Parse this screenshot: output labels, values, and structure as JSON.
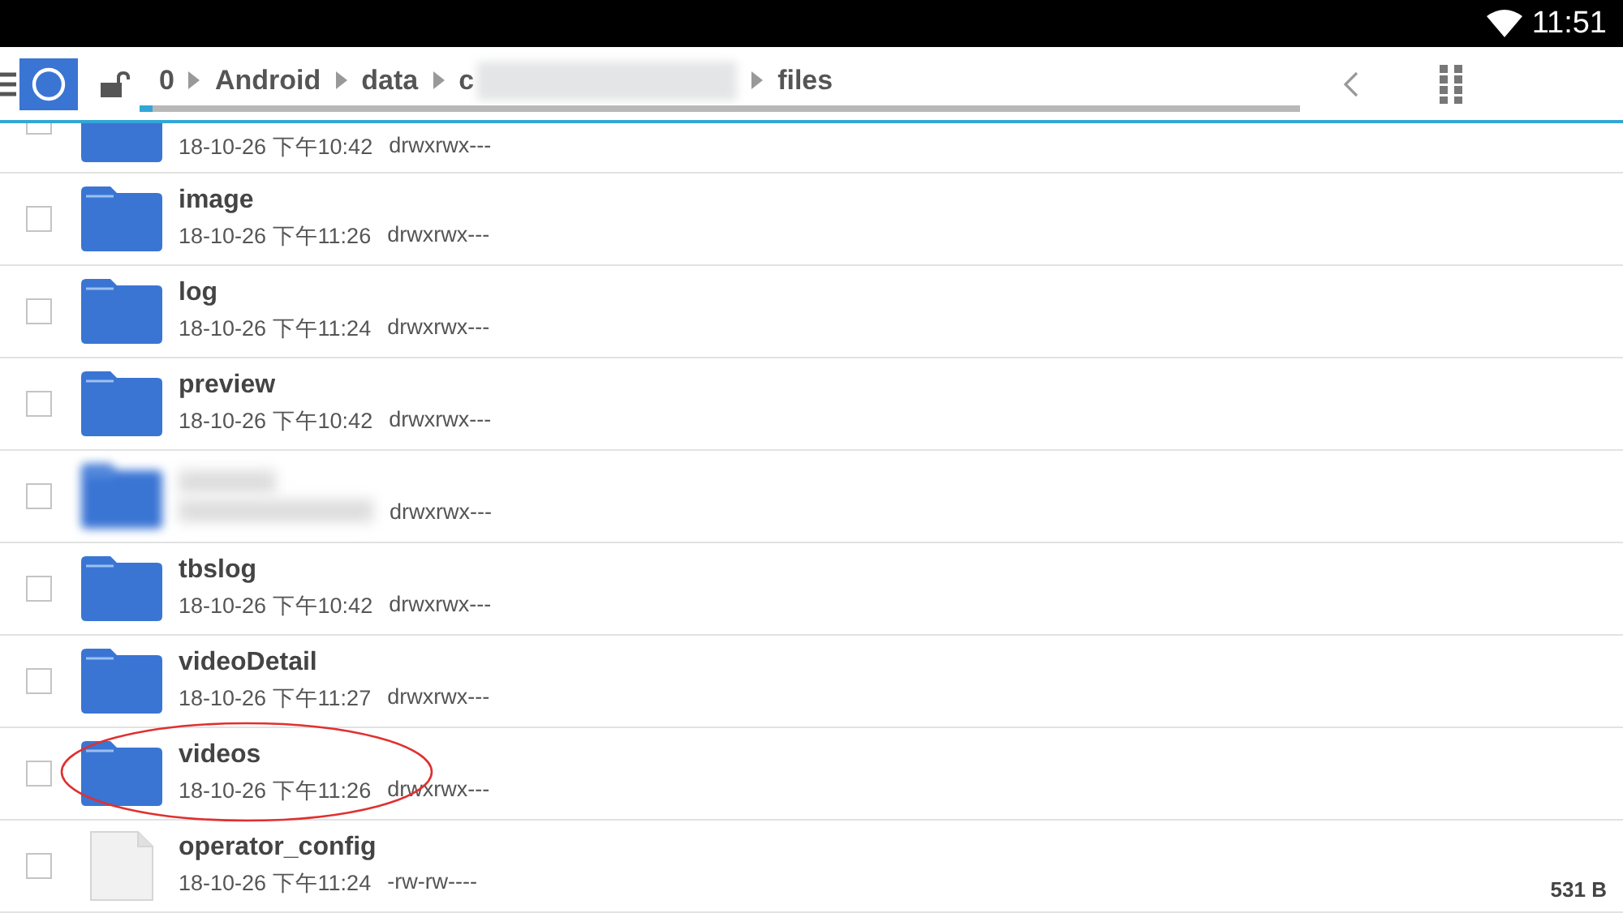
{
  "status_bar": {
    "time": "11:51"
  },
  "toolbar": {
    "breadcrumb": [
      {
        "label": "0"
      },
      {
        "label": "Android"
      },
      {
        "label": "data"
      },
      {
        "label": "c",
        "blurred": true
      },
      {
        "label": "files"
      }
    ]
  },
  "files": [
    {
      "kind": "folder",
      "partial": true,
      "date": "18-10-26 下午10:42",
      "perms": "drwxrwx---",
      "checked": false
    },
    {
      "kind": "folder",
      "name": "image",
      "date": "18-10-26 下午11:26",
      "perms": "drwxrwx---",
      "checked": false
    },
    {
      "kind": "folder",
      "name": "log",
      "date": "18-10-26 下午11:24",
      "perms": "drwxrwx---",
      "checked": false
    },
    {
      "kind": "folder",
      "name": "preview",
      "date": "18-10-26 下午10:42",
      "perms": "drwxrwx---",
      "checked": false
    },
    {
      "kind": "folder",
      "perms": "drwxrwx---",
      "checked": false,
      "blurred": true
    },
    {
      "kind": "folder",
      "name": "tbslog",
      "date": "18-10-26 下午10:42",
      "perms": "drwxrwx---",
      "checked": false
    },
    {
      "kind": "folder",
      "name": "videoDetail",
      "date": "18-10-26 下午11:27",
      "perms": "drwxrwx---",
      "checked": false
    },
    {
      "kind": "folder",
      "name": "videos",
      "date": "18-10-26 下午11:26",
      "perms": "drwxrwx---",
      "checked": false,
      "highlighted": true
    },
    {
      "kind": "file",
      "name": "operator_config",
      "date": "18-10-26 下午11:24",
      "perms": "-rw-rw----",
      "size": "531 B",
      "checked": false
    }
  ]
}
